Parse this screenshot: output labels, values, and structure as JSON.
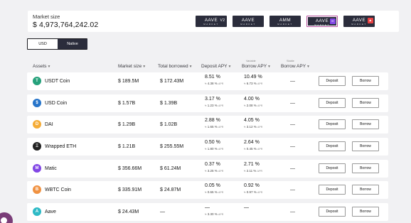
{
  "header": {
    "market_size_label": "Market size",
    "market_size_value": "$ 4,973,764,242.02",
    "markets": [
      {
        "label": "AAVE",
        "sub": "MARKET",
        "badge": "V2",
        "badge_color": "#2b2d3c",
        "active": false
      },
      {
        "label": "AAVE",
        "sub": "MARKET",
        "badge": "",
        "badge_color": "",
        "active": false
      },
      {
        "label": "AMM",
        "sub": "MARKET",
        "badge": "",
        "badge_color": "",
        "active": false
      },
      {
        "label": "AAVE",
        "sub": "MARKET",
        "badge": "∞",
        "badge_color": "#8247e5",
        "active": true
      },
      {
        "label": "AAVE",
        "sub": "MARKET",
        "badge": "▲",
        "badge_color": "#e84142",
        "active": false
      }
    ]
  },
  "toggle": {
    "usd": "USD",
    "native": "Native"
  },
  "table": {
    "headers": {
      "assets": "Assets",
      "market_size": "Market size",
      "total_borrowed": "Total borrowed",
      "deposit_apy": "Deposit APY",
      "variable_caption": "Variable",
      "borrow_apy": "Borrow APY",
      "stable_caption": "Stable",
      "stable_borrow_apy": "Borrow APY"
    },
    "apr_suffix": "APR",
    "deposit_label": "Deposit",
    "borrow_label": "Borrow",
    "rows": [
      {
        "name": "USDT Coin",
        "icon": "usdt-icon",
        "icon_color": "#26a17b",
        "icon_glyph": "T",
        "market_size": "$ 189.5M",
        "total_borrowed": "$ 172.43M",
        "deposit_apy": "8.51 %",
        "deposit_apr": "≈ 4.38 %",
        "borrow_apy": "10.49 %",
        "borrow_apr": "≈ 6.73 %",
        "stable": "—"
      },
      {
        "name": "USD Coin",
        "icon": "usdc-icon",
        "icon_color": "#2775ca",
        "icon_glyph": "$",
        "market_size": "$ 1.57B",
        "total_borrowed": "$ 1.39B",
        "deposit_apy": "3.17 %",
        "deposit_apr": "≈ 1.23 %",
        "borrow_apy": "4.00 %",
        "borrow_apr": "≈ 2.08 %",
        "stable": "—"
      },
      {
        "name": "DAI",
        "icon": "dai-icon",
        "icon_color": "#f5ac37",
        "icon_glyph": "D",
        "market_size": "$ 1.29B",
        "total_borrowed": "$ 1.02B",
        "deposit_apy": "2.88 %",
        "deposit_apr": "≈ 1.65 %",
        "borrow_apy": "4.05 %",
        "borrow_apr": "≈ 3.12 %",
        "stable": "—"
      },
      {
        "name": "Wrapped ETH",
        "icon": "weth-icon",
        "icon_color": "#222222",
        "icon_glyph": "Ξ",
        "market_size": "$ 1.21B",
        "total_borrowed": "$ 255.55M",
        "deposit_apy": "0.50 %",
        "deposit_apr": "≈ 1.80 %",
        "borrow_apy": "2.64 %",
        "borrow_apr": "≈ 0.45 %",
        "stable": "—"
      },
      {
        "name": "Matic",
        "icon": "matic-icon",
        "icon_color": "#8247e5",
        "icon_glyph": "M",
        "market_size": "$ 356.66M",
        "total_borrowed": "$ 61.24M",
        "deposit_apy": "0.37 %",
        "deposit_apr": "≈ 3.25 %",
        "borrow_apy": "2.71 %",
        "borrow_apr": "≈ 2.11 %",
        "stable": "—"
      },
      {
        "name": "WBTC Coin",
        "icon": "wbtc-icon",
        "icon_color": "#f09242",
        "icon_glyph": "B",
        "market_size": "$ 335.91M",
        "total_borrowed": "$ 24.87M",
        "deposit_apy": "0.05 %",
        "deposit_apr": "≈ 0.65 %",
        "borrow_apy": "0.92 %",
        "borrow_apr": "≈ 0.97 %",
        "stable": "—"
      },
      {
        "name": "Aave",
        "icon": "aave-icon",
        "icon_color": "#2ebac6",
        "icon_glyph": "A",
        "market_size": "$ 24.43M",
        "total_borrowed": "—",
        "deposit_apy": "—",
        "deposit_apr": "≈ 3.30 %",
        "borrow_apy": "—",
        "borrow_apr": "",
        "stable": "—"
      }
    ]
  }
}
